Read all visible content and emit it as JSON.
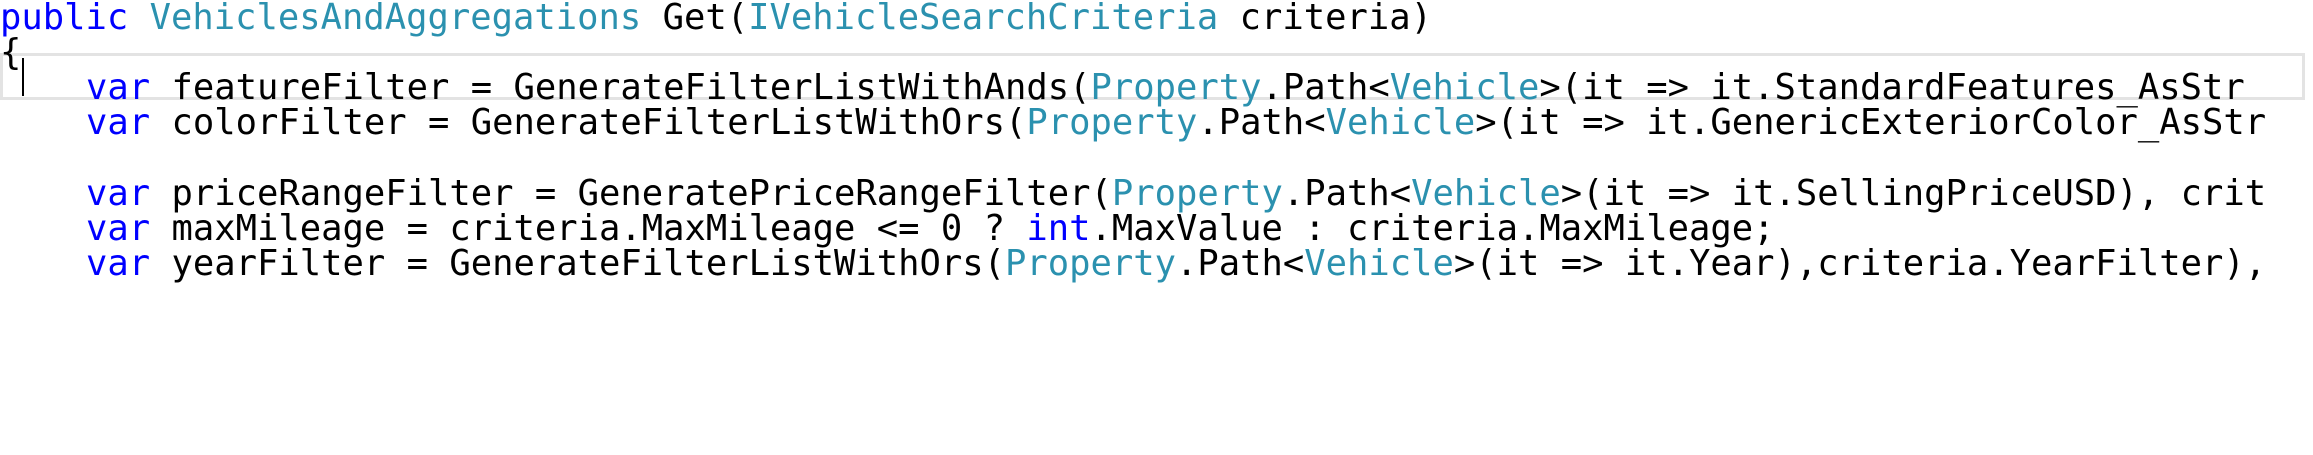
{
  "colors": {
    "keyword": "#0000ff",
    "type": "#2b91af",
    "text": "#000000",
    "current_line_border": "#e3e3e3",
    "background": "#ffffff"
  },
  "code": {
    "line1": {
      "kw": "public",
      "sp1": " ",
      "ret_type": "VehiclesAndAggregations",
      "name": " Get(",
      "param_type": "IVehicleSearchCriteria",
      "param": " criteria)"
    },
    "line2": {
      "brace": "{"
    },
    "line3": {
      "kw": "var",
      "a": " featureFilter = GenerateFilterListWithAnds(",
      "t1": "Property",
      "b": ".Path<",
      "t2": "Vehicle",
      "c": ">(it => it.StandardFeatures_AsStr"
    },
    "line4": {
      "kw": "var",
      "a": " colorFilter = GenerateFilterListWithOrs(",
      "t1": "Property",
      "b": ".Path<",
      "t2": "Vehicle",
      "c": ">(it => it.GenericExteriorColor_AsStr"
    },
    "line5": {
      "kw": "var",
      "a": " priceRangeFilter = GeneratePriceRangeFilter(",
      "t1": "Property",
      "b": ".Path<",
      "t2": "Vehicle",
      "c": ">(it => it.SellingPriceUSD), crit"
    },
    "line6": {
      "kw": "var",
      "a": " maxMileage = criteria.MaxMileage <= 0 ? ",
      "kw2": "int",
      "b": ".MaxValue : criteria.MaxMileage;"
    },
    "line7": {
      "kw": "var",
      "a": " yearFilter = GenerateFilterListWithOrs(",
      "t1": "Property",
      "b": ".Path<",
      "t2": "Vehicle",
      "c": ">(it => it.Year),criteria.YearFilter),"
    }
  }
}
